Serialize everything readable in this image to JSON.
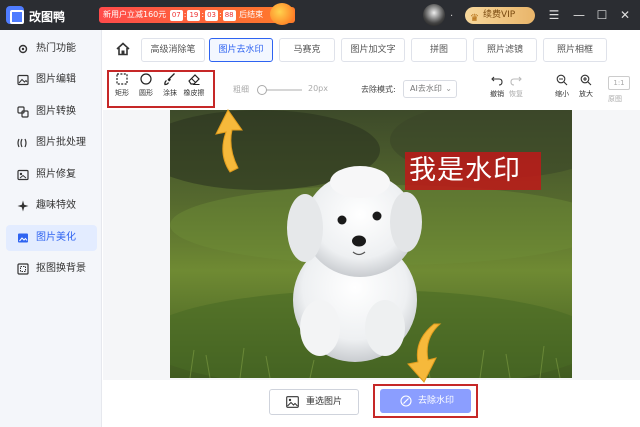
{
  "app": {
    "title": "改图鸭",
    "promo_text": "新用户立减160元",
    "promo_countdown": [
      "07",
      "19",
      "03",
      "88"
    ],
    "promo_suffix": "后结束",
    "user_name": ".",
    "vip_label": "续费VIP"
  },
  "sidebar": {
    "items": [
      {
        "label": "热门功能",
        "icon": "settings-icon"
      },
      {
        "label": "图片编辑",
        "icon": "image-edit-icon"
      },
      {
        "label": "图片转换",
        "icon": "convert-icon"
      },
      {
        "label": "图片批处理",
        "icon": "batch-icon"
      },
      {
        "label": "照片修复",
        "icon": "repair-icon"
      },
      {
        "label": "趣味特效",
        "icon": "effects-icon"
      },
      {
        "label": "图片美化",
        "icon": "beautify-icon",
        "active": true
      },
      {
        "label": "抠图换背景",
        "icon": "cutout-icon"
      }
    ]
  },
  "tabs": [
    {
      "label": "高级消除笔"
    },
    {
      "label": "图片去水印",
      "active": true
    },
    {
      "label": "马赛克"
    },
    {
      "label": "图片加文字"
    },
    {
      "label": "拼图"
    },
    {
      "label": "照片滤镜"
    },
    {
      "label": "照片相框"
    }
  ],
  "toolbar": {
    "tools": [
      {
        "label": "矩形",
        "icon": "rectangle-select-icon"
      },
      {
        "label": "圆形",
        "icon": "circle-select-icon"
      },
      {
        "label": "涂抹",
        "icon": "brush-icon"
      },
      {
        "label": "橡皮擦",
        "icon": "eraser-icon"
      }
    ],
    "brush_label": "粗细",
    "brush_size": "20px",
    "brush_value": 0.1,
    "mode_label": "去除模式:",
    "mode_value": "AI去水印",
    "undo_label": "撤销",
    "redo_label": "恢复",
    "zoom_out_label": "缩小",
    "zoom_in_label": "放大",
    "ratio_label": "1:1",
    "ratio_sub": "原图"
  },
  "canvas": {
    "watermark_text": "我是水印"
  },
  "actions": {
    "reselect_label": "重选图片",
    "remove_label": "去除水印"
  },
  "colors": {
    "accent": "#2e63f1",
    "highlight_box": "#c62828",
    "arrow": "#f6b93b"
  }
}
